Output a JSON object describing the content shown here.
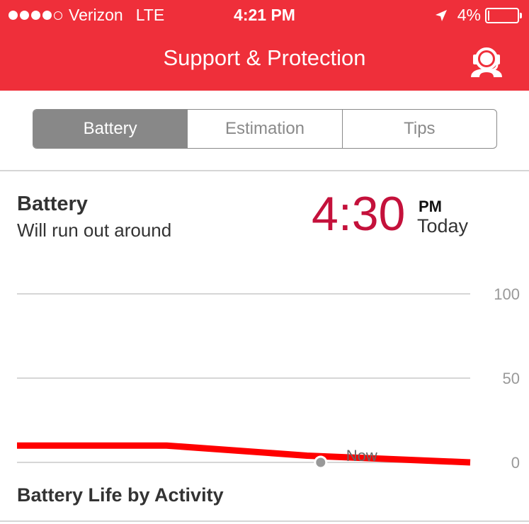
{
  "status_bar": {
    "carrier": "Verizon",
    "network": "LTE",
    "time": "4:21 PM",
    "battery_percent": "4%",
    "battery_level": 0.04,
    "signal_bars": 4,
    "signal_max": 5
  },
  "header": {
    "title": "Support & Protection",
    "background_color": "#ef2f3a",
    "support_icon": "headset-support-icon"
  },
  "tabs": [
    {
      "label": "Battery",
      "active": true
    },
    {
      "label": "Estimation",
      "active": false
    },
    {
      "label": "Tips",
      "active": false
    }
  ],
  "battery_info": {
    "title": "Battery",
    "subtitle": "Will run out around",
    "time": "4:30",
    "ampm": "PM",
    "day": "Today",
    "time_color": "#c4113b"
  },
  "chart_data": {
    "type": "line",
    "y_ticks": [
      "100",
      "50",
      "0"
    ],
    "ylim": [
      0,
      100
    ],
    "x": [
      0,
      0.33,
      0.64,
      1.0
    ],
    "series": [
      {
        "values": [
          10,
          10,
          4,
          0
        ],
        "color": "#ff0000"
      }
    ],
    "marker": {
      "label": "Now",
      "x": 0.67,
      "value": 0
    },
    "grid": true
  },
  "section": {
    "title": "Battery Life by Activity"
  }
}
